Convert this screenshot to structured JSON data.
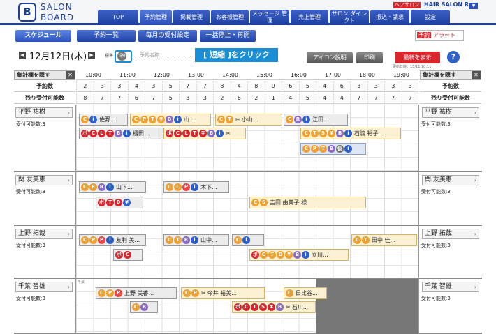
{
  "header": {
    "brand_line1": "SALON",
    "brand_line2": "BOARD",
    "logo_letter": "B",
    "tag": "ヘアサロン",
    "salon_name": "HAIR SALON R",
    "nav": [
      "TOP",
      "予約管理",
      "掲載管理",
      "お客様管理",
      "メッセージ 管理",
      "売上管理",
      "サロン ダイレクト",
      "振込・請求",
      "設定"
    ]
  },
  "subnav": [
    "スケジュール",
    "予約一覧",
    "毎月の受付設定",
    "一括停止・再開"
  ],
  "alert": {
    "badge": "予約",
    "label": "アラート"
  },
  "date": "12月12日(木)",
  "view_toggle": {
    "standard": "標準",
    "compact": "短縮",
    "placeholder": "予約名称"
  },
  "callout": "[ 短縮 ]をクリック",
  "buttons": {
    "icon_help": "アイコン説明",
    "print": "印刷",
    "refresh": "最新を表示"
  },
  "timestamp": "更新日時：15/11 10:11",
  "hide_summary": "集計欄を隠す",
  "times": [
    "10:00",
    "11:00",
    "12:00",
    "13:00",
    "14:00",
    "15:00",
    "16:00",
    "17:00",
    "18:00",
    "19:00"
  ],
  "row_labels": {
    "reservations": "予約数",
    "remaining": "残り受付可能数"
  },
  "reservation_counts": [
    "2",
    "3",
    "3",
    "4",
    "3",
    "5",
    "7",
    "7",
    "8",
    "4",
    "8",
    "9",
    "6",
    "5",
    "4",
    "6",
    "3",
    "3",
    "3",
    "3"
  ],
  "remaining_counts": [
    "8",
    "7",
    "7",
    "6",
    "7",
    "5",
    "3",
    "3",
    "2",
    "6",
    "2",
    "1",
    "4",
    "5",
    "4",
    "4",
    "7",
    "7",
    "7",
    "7"
  ],
  "staff": [
    {
      "name": "平野 祐樹",
      "cap": "受付可能数:3"
    },
    {
      "name": "関 友美恵",
      "cap": "受付可能数:3"
    },
    {
      "name": "上野 拓哉",
      "cap": "受付可能数:3"
    },
    {
      "name": "千葉 智雄",
      "cap": "受付可能数:3"
    }
  ],
  "reservations": {
    "r1": "佐野...",
    "r2": "山...",
    "r3": "小山...",
    "r4": "江田...",
    "r5": "榎田...",
    "r6": "石渡 裕子...",
    "r7": "山下...",
    "r8": "木下...",
    "r9": "吉田 由美子 様",
    "r10": "友利 美...",
    "r11": "山中...",
    "r12": "立川...",
    "r13": "田中 佳...",
    "r14": "上野 美香...",
    "r15": "今井 裕美...",
    "r16": "日比谷...",
    "r17": "石川..."
  },
  "time_label": "千葉"
}
